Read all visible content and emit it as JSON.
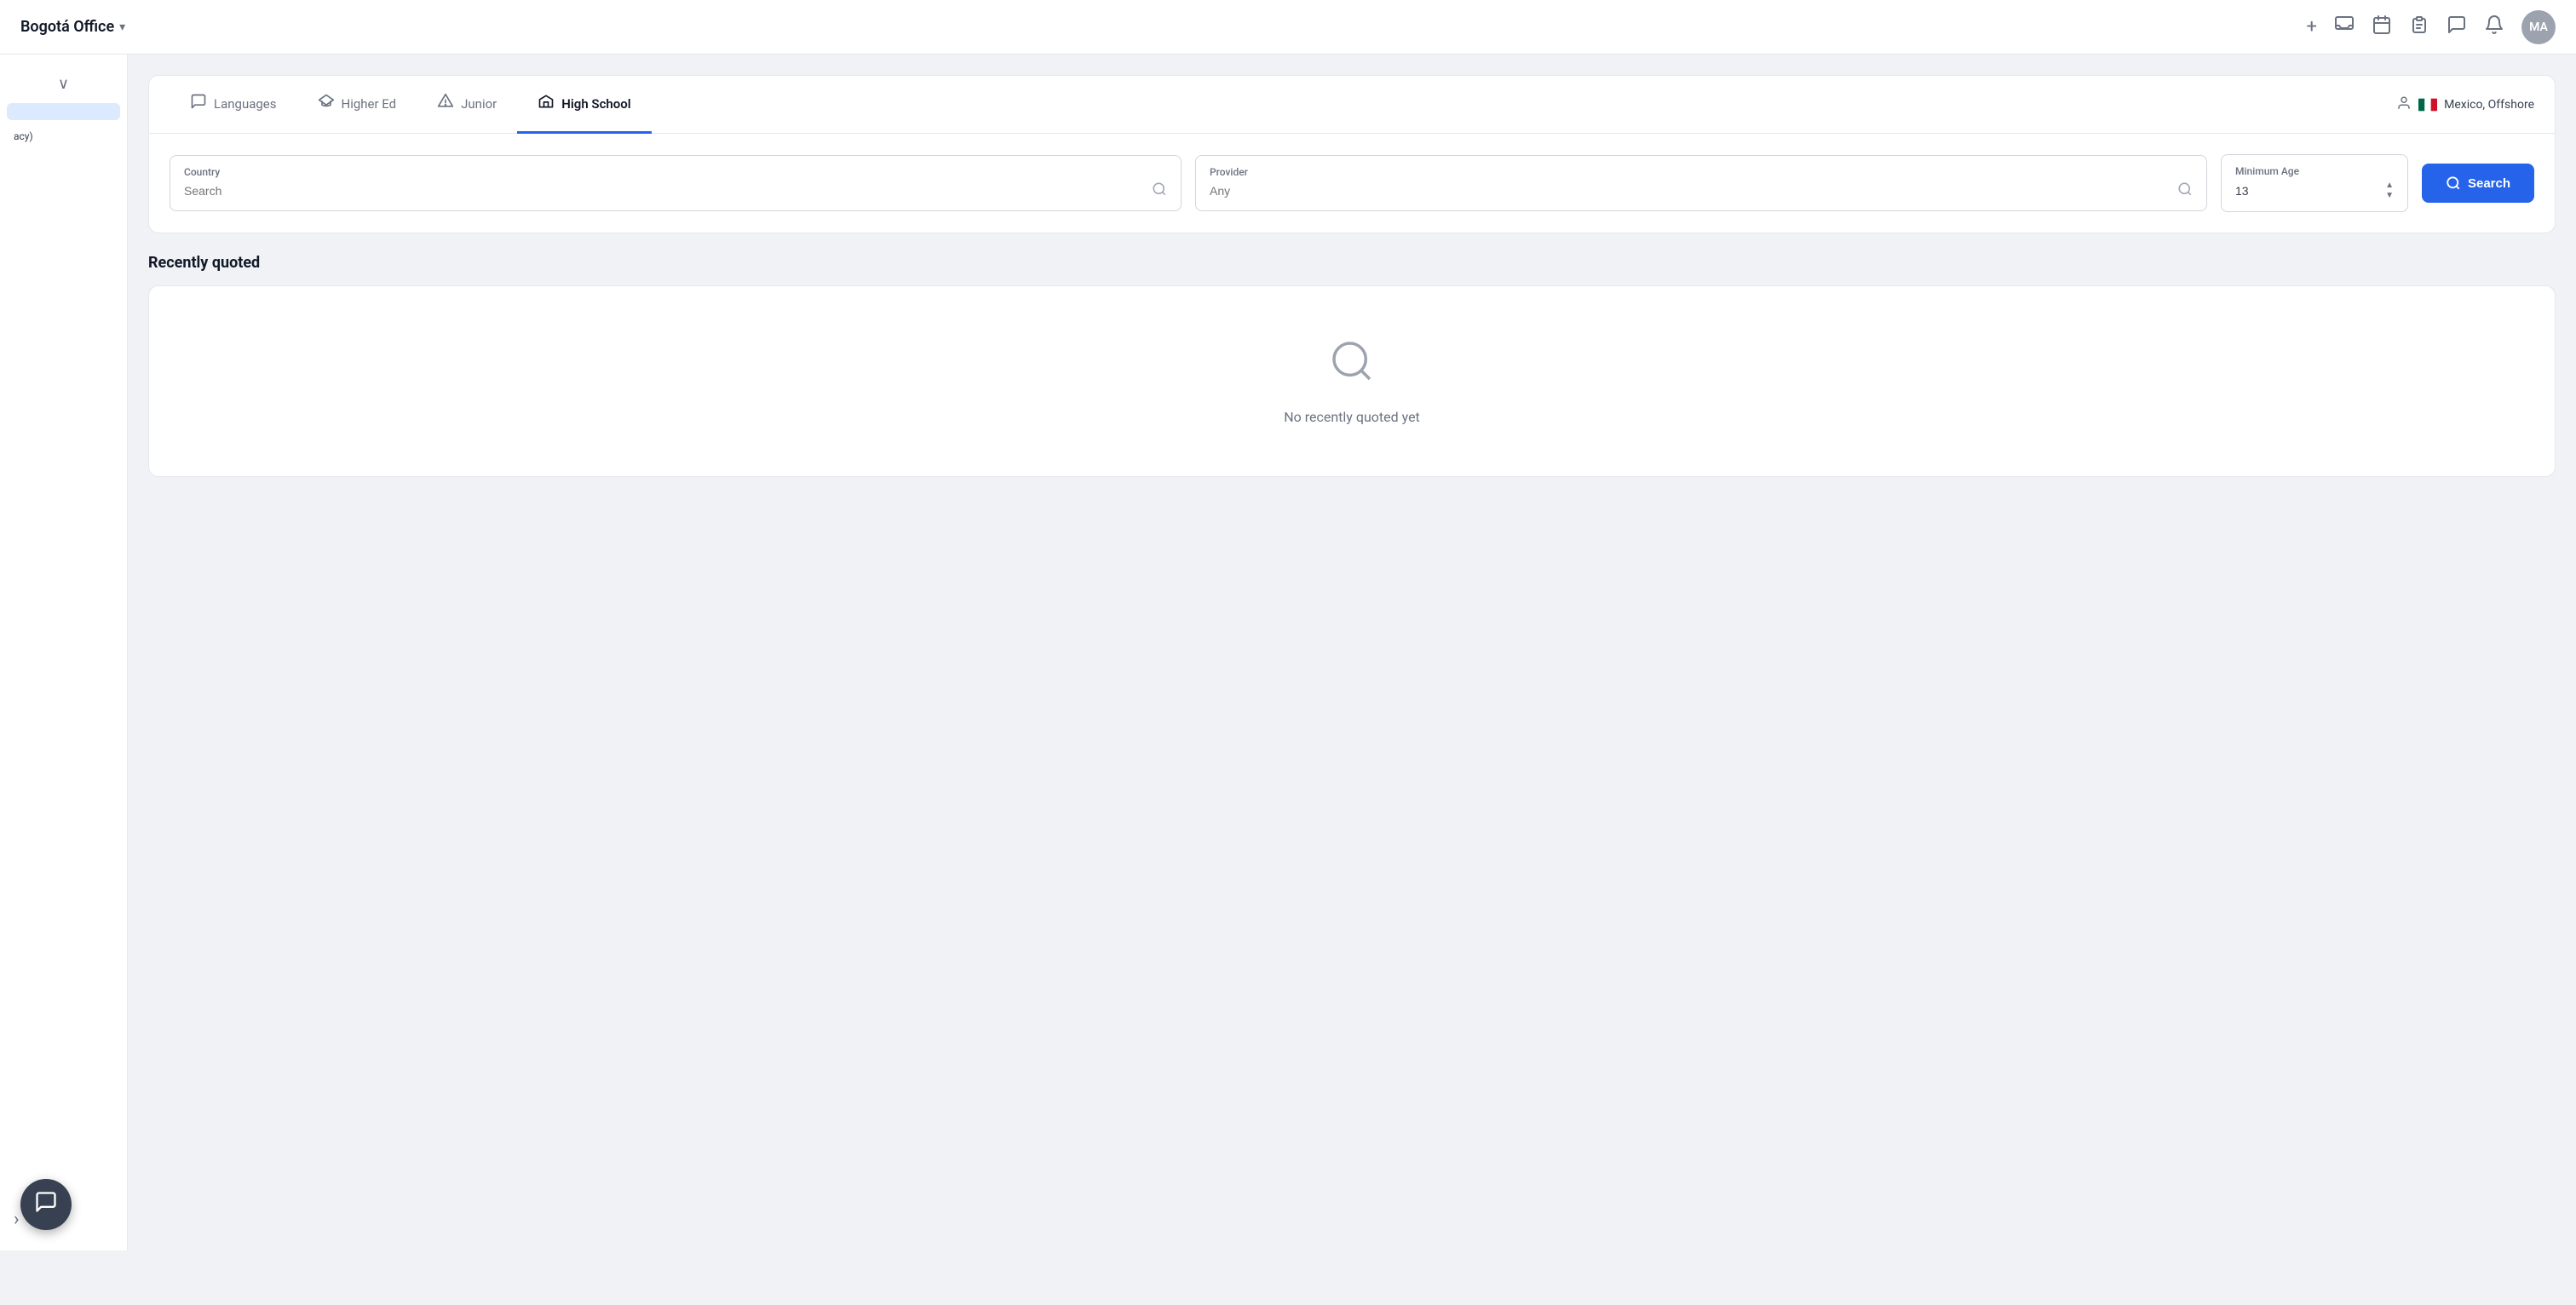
{
  "topbar": {
    "title": "Bogotá Office",
    "chevron": "▾",
    "avatar_initials": "MA",
    "icons": {
      "plus": "+",
      "inbox": "⊟",
      "calendar": "▦",
      "clipboard": "📋",
      "chat": "💬",
      "bell": "🔔"
    }
  },
  "sidebar": {
    "collapse_icon": "∨",
    "active_item": "",
    "legacy_text": "acy)",
    "expand_icon": "›"
  },
  "tabs": [
    {
      "id": "languages",
      "label": "Languages",
      "icon": "💬",
      "active": false
    },
    {
      "id": "higher-ed",
      "label": "Higher Ed",
      "icon": "🎓",
      "active": false
    },
    {
      "id": "junior",
      "label": "Junior",
      "icon": "⛺",
      "active": false
    },
    {
      "id": "high-school",
      "label": "High School",
      "icon": "🏫",
      "active": true
    }
  ],
  "user_info": {
    "icon": "👤",
    "flag_label": "MX",
    "label": "Mexico, Offshore"
  },
  "filters": {
    "country": {
      "label": "Country",
      "placeholder": "Search",
      "value": ""
    },
    "provider": {
      "label": "Provider",
      "placeholder": "Any",
      "value": ""
    },
    "minimum_age": {
      "label": "Minimum Age",
      "value": "13"
    }
  },
  "search_button": {
    "label": "Search"
  },
  "recently_quoted": {
    "title": "Recently quoted",
    "empty_text": "No recently quoted yet"
  },
  "chat_bubble": {
    "icon": "💬"
  }
}
